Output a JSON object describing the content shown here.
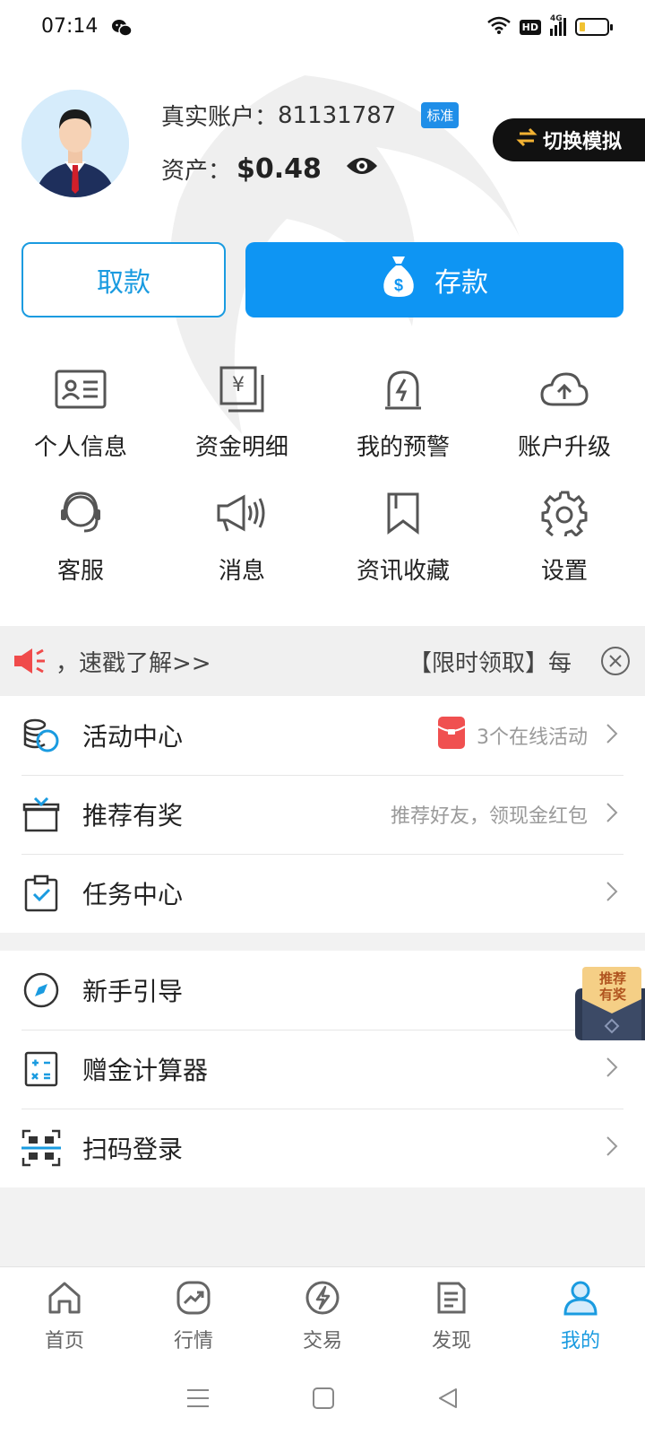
{
  "status_bar": {
    "time": "07:14",
    "hd_label": "HD",
    "network": "4G"
  },
  "account": {
    "type_label": "真实账户：",
    "account_number": "81131787",
    "badge": "标准",
    "asset_label": "资产：",
    "asset_value": "$0.48",
    "switch_label": "切换模拟"
  },
  "actions": {
    "withdraw_label": "取款",
    "deposit_label": "存款"
  },
  "grid": {
    "items": [
      {
        "label": "个人信息",
        "icon": "id-card-icon"
      },
      {
        "label": "资金明细",
        "icon": "yuan-document-icon"
      },
      {
        "label": "我的预警",
        "icon": "alert-icon"
      },
      {
        "label": "账户升级",
        "icon": "cloud-upload-icon"
      },
      {
        "label": "客服",
        "icon": "headset-icon"
      },
      {
        "label": "消息",
        "icon": "megaphone-icon"
      },
      {
        "label": "资讯收藏",
        "icon": "bookmark-icon"
      },
      {
        "label": "设置",
        "icon": "gear-icon"
      }
    ]
  },
  "marquee": {
    "left_text": "，速戳了解>>",
    "right_text": "【限时领取】每"
  },
  "list_primary": [
    {
      "label": "活动中心",
      "right_text": "3个在线活动",
      "icon": "coins-icon"
    },
    {
      "label": "推荐有奖",
      "right_text": "推荐好友，领现金红包",
      "icon": "gift-icon"
    },
    {
      "label": "任务中心",
      "right_text": "",
      "icon": "clipboard-check-icon"
    }
  ],
  "list_secondary": [
    {
      "label": "新手引导",
      "icon": "compass-icon"
    },
    {
      "label": "赠金计算器",
      "icon": "calculator-icon"
    },
    {
      "label": "扫码登录",
      "icon": "qr-scan-icon"
    }
  ],
  "float_ref": {
    "label_line1": "推荐",
    "label_line2": "有奖"
  },
  "bottom_nav": [
    {
      "label": "首页",
      "icon": "home-icon"
    },
    {
      "label": "行情",
      "icon": "trend-icon"
    },
    {
      "label": "交易",
      "icon": "lightning-icon"
    },
    {
      "label": "发现",
      "icon": "document-icon"
    },
    {
      "label": "我的",
      "icon": "person-icon",
      "active": true
    }
  ],
  "colors": {
    "primary": "#0e95f3",
    "accent": "#1a9be0",
    "background": "#f2f2f2"
  }
}
